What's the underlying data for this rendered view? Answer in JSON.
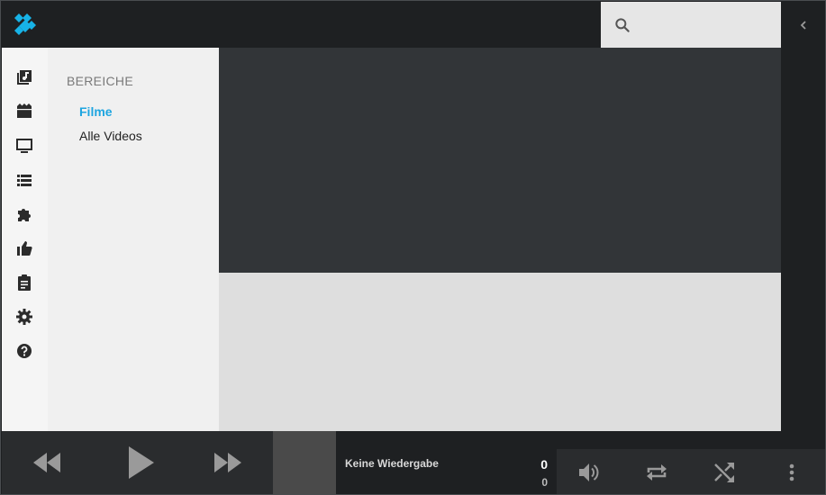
{
  "header": {
    "logo_icon": "kodi-logo-icon",
    "search": {
      "placeholder": "",
      "value": "",
      "icon": "search-icon"
    },
    "collapse_icon": "chevron-left-icon"
  },
  "nav_icons": [
    {
      "icon": "music-library-icon"
    },
    {
      "icon": "movies-icon"
    },
    {
      "icon": "tv-icon"
    },
    {
      "icon": "playlist-icon"
    },
    {
      "icon": "addons-icon"
    },
    {
      "icon": "thumbs-up-icon"
    },
    {
      "icon": "clipboard-icon"
    },
    {
      "icon": "settings-gear-icon"
    },
    {
      "icon": "help-icon"
    }
  ],
  "sections": {
    "heading": "BEREICHE",
    "items": [
      {
        "label": "Filme",
        "active": true
      },
      {
        "label": "Alle Videos",
        "active": false
      }
    ]
  },
  "player": {
    "now_playing": "Keine Wiedergabe",
    "time_current": "0",
    "time_total": "0",
    "controls": [
      "rewind-icon",
      "play-icon",
      "fast-forward-icon",
      "volume-icon",
      "repeat-icon",
      "shuffle-icon",
      "more-vert-icon"
    ]
  },
  "colors": {
    "accent": "#1ea5e0",
    "dark": "#1e2022",
    "content_dark": "#323538",
    "content_light": "#dedede"
  }
}
